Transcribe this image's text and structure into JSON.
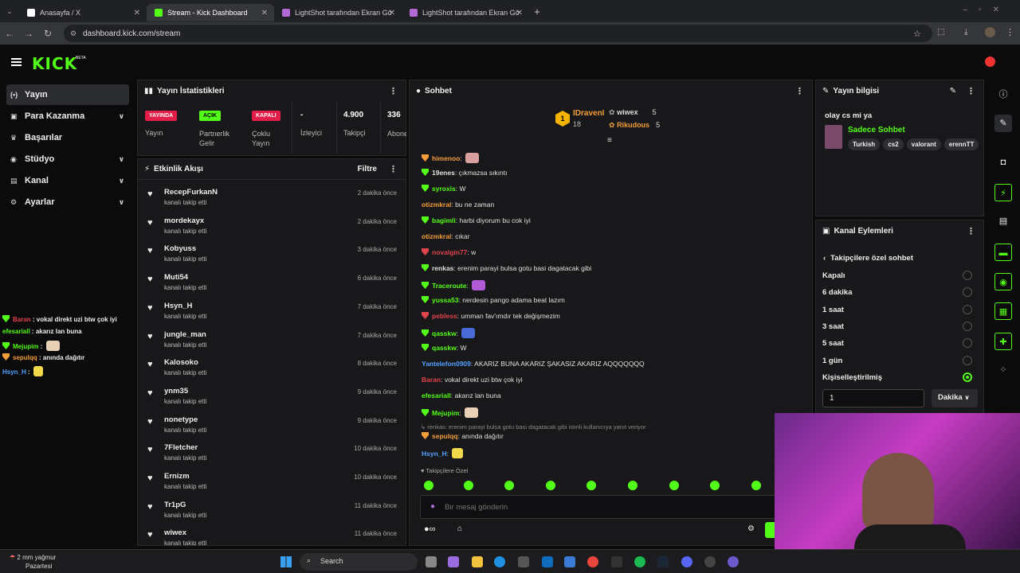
{
  "browser": {
    "tabs": [
      {
        "title": "Anasayfa / X"
      },
      {
        "title": "Stream - Kick Dashboard"
      },
      {
        "title": "LightShot tarafından Ekran Gö"
      },
      {
        "title": "LightShot tarafından Ekran Gö"
      }
    ],
    "url": "dashboard.kick.com/stream"
  },
  "brand": {
    "logo": "KICK",
    "beta": "BETA",
    "accent": "#53fc18"
  },
  "sidebar": {
    "items": [
      {
        "label": "Yayın",
        "icon": "broadcast-icon"
      },
      {
        "label": "Para Kazanma",
        "icon": "money-icon"
      },
      {
        "label": "Başarılar",
        "icon": "trophy-icon"
      },
      {
        "label": "Stüdyo",
        "icon": "studio-icon"
      },
      {
        "label": "Kanal",
        "icon": "channel-icon"
      },
      {
        "label": "Ayarlar",
        "icon": "gear-icon"
      }
    ]
  },
  "stats": {
    "title": "Yayın İstatistikleri",
    "items": [
      {
        "badge": "YAYINDA",
        "label": "Yayın"
      },
      {
        "badge": "AÇIK",
        "label": "Partnerlik Gelir Programı"
      },
      {
        "badge": "KAPALI",
        "label": "Çoklu Yayın"
      },
      {
        "value": "-",
        "label": "İzleyici"
      },
      {
        "value": "4.900",
        "label": "Takipçi"
      },
      {
        "value": "336",
        "label": "Abone Sayısı"
      }
    ]
  },
  "feed": {
    "title": "Etkinlik Akışı",
    "filter": "Filtre",
    "action": "kanalı takip etti",
    "rows": [
      {
        "name": "RecepFurkanN",
        "time": "2 dakika önce"
      },
      {
        "name": "mordekayx",
        "time": "2 dakika önce"
      },
      {
        "name": "Kobyuss",
        "time": "3 dakika önce"
      },
      {
        "name": "Muti54",
        "time": "6 dakika önce"
      },
      {
        "name": "Hsyn_H",
        "time": "7 dakika önce"
      },
      {
        "name": "jungle_man",
        "time": "7 dakika önce"
      },
      {
        "name": "Kalosoko",
        "time": "8 dakika önce"
      },
      {
        "name": "ynm35",
        "time": "9 dakika önce"
      },
      {
        "name": "nonetype",
        "time": "9 dakika önce"
      },
      {
        "name": "7Fletcher",
        "time": "10 dakika önce"
      },
      {
        "name": "Ernizm",
        "time": "10 dakika önce"
      },
      {
        "name": "Tr1pG",
        "time": "11 dakika önce"
      },
      {
        "name": "wiwex",
        "time": "11 dakika önce"
      }
    ]
  },
  "chat": {
    "title": "Sohbet",
    "leaders": [
      {
        "name": "IDravenI",
        "count": "18"
      },
      {
        "name": "wiwex",
        "count": "5"
      },
      {
        "name": "Rikudous",
        "count": "5"
      }
    ],
    "rank": "1",
    "messages": [
      {
        "user": "himenoo",
        "color": "#f39c3a",
        "text": ""
      },
      {
        "user": "19enes",
        "color": "#e0e0e0",
        "text": "çıkmazsa sıkıntı"
      },
      {
        "user": "syroxis",
        "color": "#53fc18",
        "text": "W"
      },
      {
        "user": "otizmkral",
        "color": "#f39c3a",
        "text": "bu ne zaman"
      },
      {
        "user": "bagimli",
        "color": "#53fc18",
        "text": "harbi diyorum bu cok iyi"
      },
      {
        "user": "otizmkral",
        "color": "#f39c3a",
        "text": "cıkar"
      },
      {
        "user": "novalgin77",
        "color": "#e0444c",
        "text": "w"
      },
      {
        "user": "renkas",
        "color": "#e0e0e0",
        "text": "erenim parayi bulsa gotu basi dagatacak gibi"
      },
      {
        "user": "Traceroute",
        "color": "#53fc18",
        "text": ""
      },
      {
        "user": "yussa53",
        "color": "#53fc18",
        "text": "nerdesin pango adama beat lazım"
      },
      {
        "user": "pebless",
        "color": "#e0444c",
        "text": "umman fav'ımdır tek değişmezim"
      },
      {
        "user": "qasskw",
        "color": "#53fc18",
        "text": ""
      },
      {
        "user": "qasskw",
        "color": "#53fc18",
        "text": "W"
      },
      {
        "user": "Yantelefon0909",
        "color": "#54a0ff",
        "text": "AKARIZ BUNA AKARIZ ŞAKASIZ AKARIZ AQQQQQQQ"
      },
      {
        "user": "Baran",
        "color": "#e0444c",
        "text": "vokal direkt uzi btw çok iyi"
      },
      {
        "user": "efesariall",
        "color": "#53fc18",
        "text": "akarız lan buna"
      },
      {
        "user": "Mejupim",
        "color": "#53fc18",
        "text": ""
      }
    ],
    "reply_note": "renkas: erenim parayi bulsa gotu basi dagatacak gibi isimli kullanıcıya yanıt veriyor",
    "after_reply": [
      {
        "user": "sepulqq",
        "color": "#f39c3a",
        "text": "anında dağıtır"
      },
      {
        "user": "Hsyn_H",
        "color": "#54a0ff",
        "text": ""
      }
    ],
    "followers_only": "Takipçilere Özel",
    "placeholder": "Bir mesaj gönderin"
  },
  "overlay": {
    "lines": [
      {
        "user": "Baran",
        "color": "#e0444c",
        "text": "vokal direkt uzi btw çok iyi"
      },
      {
        "user": "efesariall",
        "color": "#53fc18",
        "text": "akarız lan buna"
      },
      {
        "user": "Mejupim",
        "color": "#53fc18",
        "text": ""
      },
      {
        "user": "sepulqq",
        "color": "#f39c3a",
        "text": "anında dağıtır"
      },
      {
        "user": "Hsyn_H",
        "color": "#54a0ff",
        "text": ""
      }
    ]
  },
  "info": {
    "title": "Yayın bilgisi",
    "stream_title": "olay cs mi ya",
    "category": "Sadece Sohbet",
    "tags": [
      "Turkish",
      "cs2",
      "valorant",
      "erennTT"
    ]
  },
  "actions": {
    "title": "Kanal Eylemleri",
    "sub": "Takipçilere özel sohbet",
    "options": [
      {
        "label": "Kapalı",
        "on": false
      },
      {
        "label": "6 dakika",
        "on": false
      },
      {
        "label": "1 saat",
        "on": false
      },
      {
        "label": "3 saat",
        "on": false
      },
      {
        "label": "5 saat",
        "on": false
      },
      {
        "label": "1 gün",
        "on": false
      },
      {
        "label": "Kişiselleştirilmiş",
        "on": true
      }
    ],
    "input_value": "1",
    "unit": "Dakika"
  },
  "taskbar": {
    "weather": "2 mm yağmur",
    "day": "Pazartesi",
    "search": "Search"
  }
}
